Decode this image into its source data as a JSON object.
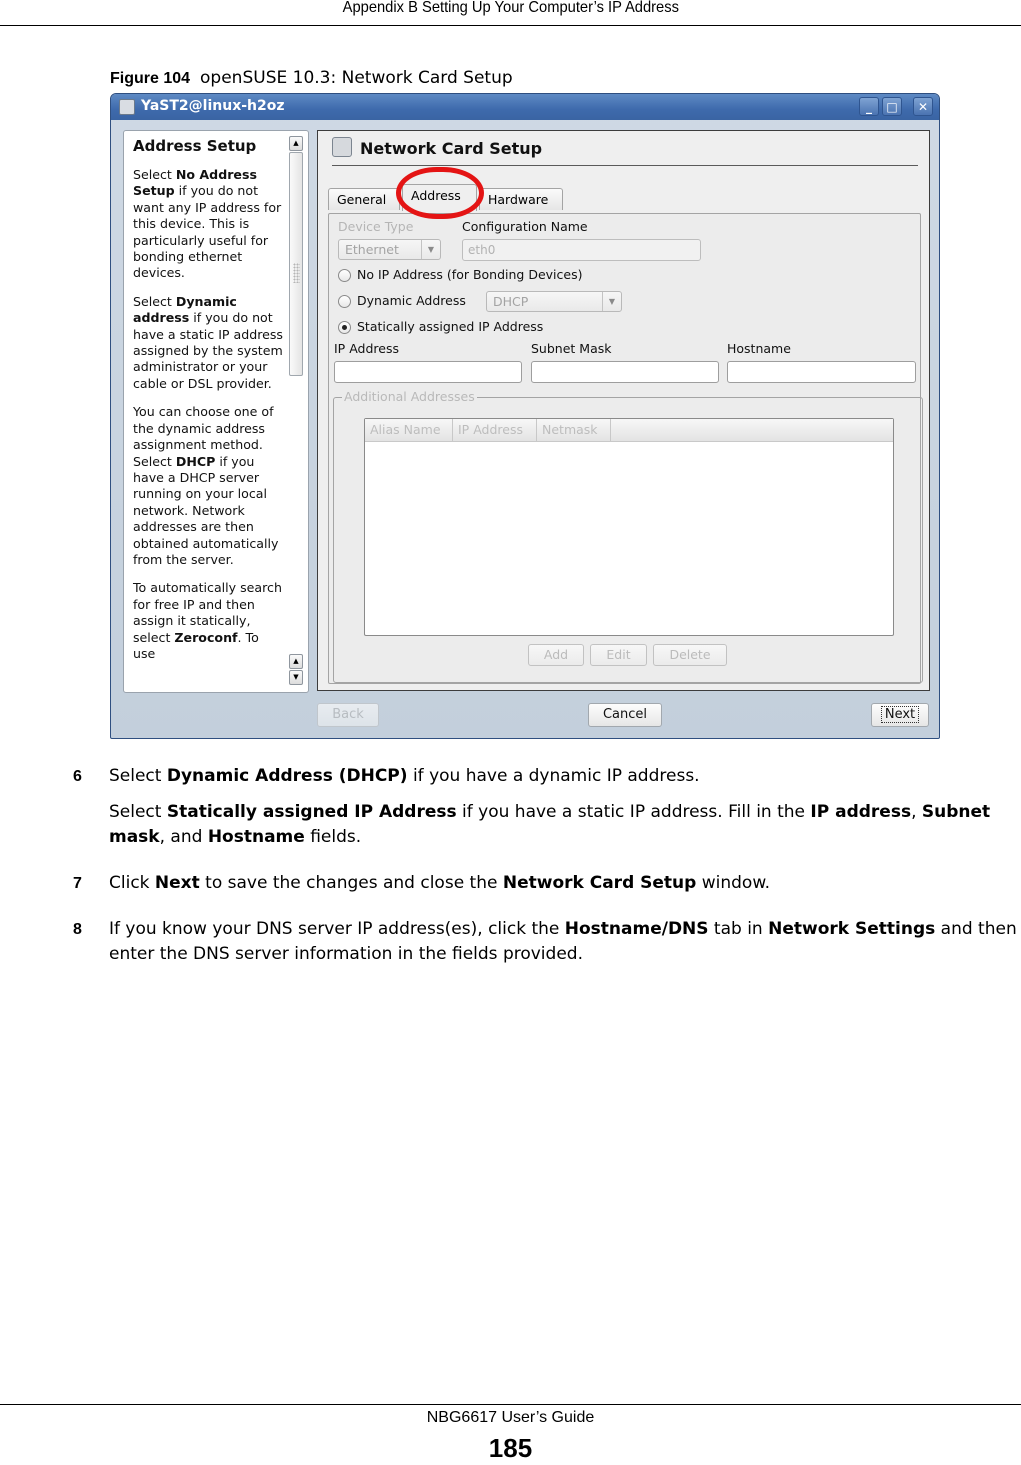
{
  "page_header": "Appendix B Setting Up Your Computer’s IP Address",
  "figure": {
    "label": "Figure 104",
    "caption": "openSUSE 10.3: Network Card Setup"
  },
  "window": {
    "title": "YaST2@linux-h2oz",
    "controls": {
      "minimize": "_",
      "maximize": "□",
      "close": "✕"
    },
    "help": {
      "heading": "Address Setup",
      "paragraphs": [
        [
          {
            "t": "Select "
          },
          {
            "b": "No Address Setup"
          },
          {
            "t": " if you do not want any IP address for this device. This is particularly useful for bonding ethernet devices."
          }
        ],
        [
          {
            "t": "Select "
          },
          {
            "b": "Dynamic address"
          },
          {
            "t": " if you do not have a static IP address assigned by the system administrator or your cable or DSL provider."
          }
        ],
        [
          {
            "t": "You can choose one of the dynamic address assignment method. Select "
          },
          {
            "b": "DHCP"
          },
          {
            "t": " if you have a DHCP server running on your local network. Network addresses are then obtained automatically from the server."
          }
        ],
        [
          {
            "t": "To automatically search for free IP and then assign it statically, select "
          },
          {
            "b": "Zeroconf"
          },
          {
            "t": ". To use"
          }
        ]
      ]
    },
    "main": {
      "title": "Network Card Setup",
      "tabs": [
        {
          "label": "General",
          "active": false
        },
        {
          "label": "Address",
          "active": true
        },
        {
          "label": "Hardware",
          "active": false
        }
      ],
      "device_type": {
        "label": "Device Type",
        "value": "Ethernet",
        "disabled": true
      },
      "configuration_name": {
        "label": "Configuration Name",
        "value": "eth0",
        "disabled": true
      },
      "radios": [
        {
          "label": "No IP Address (for Bonding Devices)",
          "checked": false
        },
        {
          "label": "Dynamic Address",
          "checked": false
        },
        {
          "label": "Statically assigned IP Address",
          "checked": true
        }
      ],
      "dynamic_method": {
        "value": "DHCP",
        "disabled": true
      },
      "fields": [
        {
          "label": "IP Address",
          "value": ""
        },
        {
          "label": "Subnet Mask",
          "value": ""
        },
        {
          "label": "Hostname",
          "value": ""
        }
      ],
      "additional": {
        "legend": "Additional Addresses",
        "columns": [
          "Alias Name",
          "IP Address",
          "Netmask"
        ],
        "rows": [],
        "buttons": [
          "Add",
          "Edit",
          "Delete"
        ]
      }
    },
    "footer_buttons": {
      "back": "Back",
      "cancel": "Cancel",
      "next": "Next"
    }
  },
  "steps": [
    {
      "num": "6",
      "parts": [
        {
          "t": "Select "
        },
        {
          "b": "Dynamic Address (DHCP)"
        },
        {
          "t": " if you have a dynamic IP address."
        }
      ]
    },
    {
      "num": "",
      "parts": [
        {
          "t": "Select "
        },
        {
          "b": "Statically assigned IP Address"
        },
        {
          "t": " if you have a static IP address. Fill in the "
        },
        {
          "b": "IP address"
        },
        {
          "t": ", "
        },
        {
          "b": "Subnet mask"
        },
        {
          "t": ", and "
        },
        {
          "b": "Hostname"
        },
        {
          "t": " fields."
        }
      ]
    },
    {
      "num": "7",
      "parts": [
        {
          "t": "Click "
        },
        {
          "b": "Next"
        },
        {
          "t": " to save the changes and close the "
        },
        {
          "b": "Network Card Setup"
        },
        {
          "t": " window."
        }
      ]
    },
    {
      "num": "8",
      "parts": [
        {
          "t": "If you know your DNS server IP address(es), click the "
        },
        {
          "b": "Hostname/DNS"
        },
        {
          "t": " tab in "
        },
        {
          "b": "Network Settings"
        },
        {
          "t": " and then enter the DNS server information in the fields provided."
        }
      ]
    }
  ],
  "footer": {
    "guide": "NBG6617 User’s Guide",
    "page_number": "185"
  }
}
